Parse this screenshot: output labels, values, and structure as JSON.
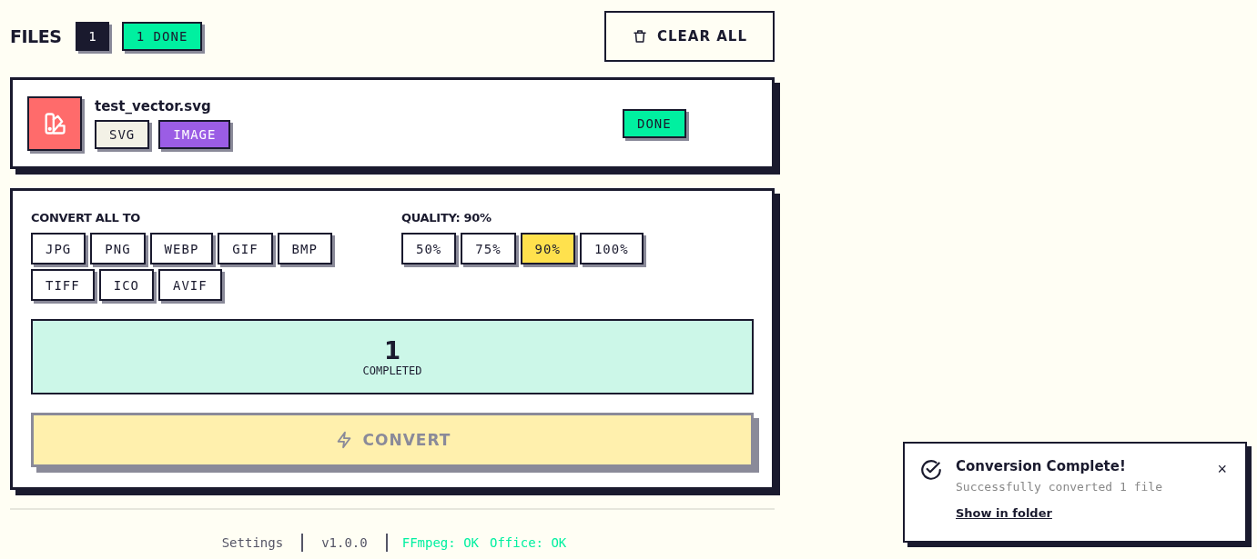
{
  "header": {
    "title": "FILES",
    "count": "1",
    "done_badge": "1 DONE",
    "clear_button": "CLEAR ALL"
  },
  "files": [
    {
      "name": "test_vector.svg",
      "tags": [
        {
          "label": "SVG",
          "kind": "format"
        },
        {
          "label": "IMAGE",
          "kind": "category"
        }
      ],
      "status": "DONE"
    }
  ],
  "convert": {
    "label": "CONVERT ALL TO",
    "formats": [
      {
        "label": "JPG",
        "selected": false
      },
      {
        "label": "PNG",
        "selected": false
      },
      {
        "label": "WEBP",
        "selected": false
      },
      {
        "label": "GIF",
        "selected": false
      },
      {
        "label": "BMP",
        "selected": false
      },
      {
        "label": "TIFF",
        "selected": false
      },
      {
        "label": "ICO",
        "selected": false
      },
      {
        "label": "AVIF",
        "selected": false
      }
    ]
  },
  "quality": {
    "label": "QUALITY: 90%",
    "options": [
      {
        "label": "50%",
        "selected": false
      },
      {
        "label": "75%",
        "selected": false
      },
      {
        "label": "90%",
        "selected": true
      },
      {
        "label": "100%",
        "selected": false
      }
    ]
  },
  "summary": {
    "value": "1",
    "label": "COMPLETED"
  },
  "convert_button": {
    "label": "CONVERT",
    "disabled": true
  },
  "footer": [
    {
      "text": "Settings",
      "kind": "link"
    },
    {
      "text": "v1.0.0",
      "kind": "plain"
    },
    {
      "text": "FFmpeg: OK",
      "kind": "ok"
    },
    {
      "text": "Office: OK",
      "kind": "ok"
    }
  ],
  "toast": {
    "title": "Conversion Complete!",
    "message": "Successfully converted 1 file",
    "link": "Show in folder",
    "close": "×"
  }
}
